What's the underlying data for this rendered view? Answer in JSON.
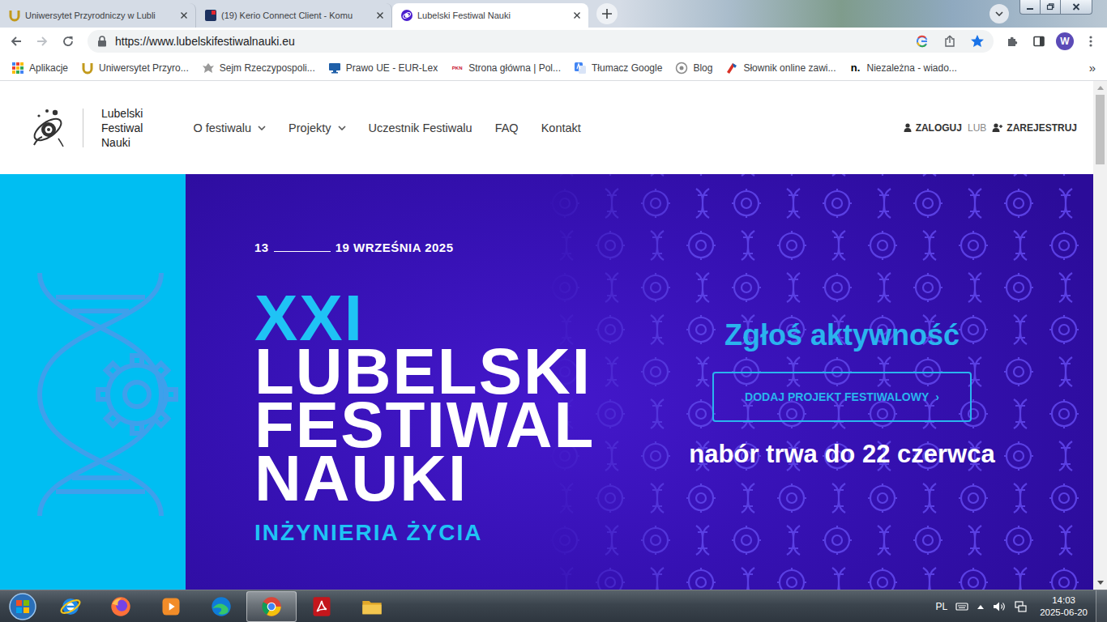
{
  "browser": {
    "tabs": [
      {
        "label": "Uniwersytet Przyrodniczy w Lubli",
        "kind": "up",
        "selected": false
      },
      {
        "label": "(19) Kerio Connect Client - Komu",
        "kind": "kerio",
        "selected": false
      },
      {
        "label": "Lubelski Festiwal Nauki",
        "kind": "lfn",
        "selected": true
      }
    ],
    "address": "https://www.lubelskifestiwalnauki.eu",
    "bookmarked": true,
    "profile": "W",
    "bookmarks": [
      {
        "label": "Aplikacje",
        "kind": "apps"
      },
      {
        "label": "Uniwersytet Przyro...",
        "kind": "up"
      },
      {
        "label": "Sejm Rzeczypospoli...",
        "kind": "sejm"
      },
      {
        "label": "Prawo UE - EUR-Lex",
        "kind": "eurlex"
      },
      {
        "label": "Strona główna | Pol...",
        "kind": "pkn",
        "mark": "PKN"
      },
      {
        "label": "Tłumacz Google",
        "kind": "translate"
      },
      {
        "label": "Blog",
        "kind": "blog"
      },
      {
        "label": "Słownik online zawi...",
        "kind": "slownik"
      },
      {
        "label": "Niezależna - wiado...",
        "kind": "niezalezna",
        "mark": "n."
      }
    ],
    "bookmarks_more": "»",
    "scrollbar": {
      "position": 0,
      "visible_share": 0.145
    }
  },
  "site": {
    "logo": [
      "Lubelski",
      "Festiwal",
      "Nauki"
    ],
    "nav": [
      {
        "label": "O festiwalu",
        "has_menu": true
      },
      {
        "label": "Projekty",
        "has_menu": true
      },
      {
        "label": "Uczestnik Festiwalu",
        "has_menu": false
      },
      {
        "label": "FAQ",
        "has_menu": false
      },
      {
        "label": "Kontakt",
        "has_menu": false
      }
    ],
    "auth": {
      "login": "ZALOGUJ",
      "or": "LUB",
      "register": "ZAREJESTRUJ"
    }
  },
  "hero": {
    "date_start": "13",
    "date_end": "19 WRZEŚNIA 2025",
    "edition": "XXI",
    "title": [
      "LUBELSKI",
      "FESTIWAL",
      "NAUKI"
    ],
    "theme": "INŻYNIERIA ŻYCIA",
    "cta_heading": "Zgłoś aktywność",
    "cta_button": "DODAJ PROJEKT FESTIWALOWY",
    "cta_arrow": "›",
    "deadline": "nabór trwa do 22 czerwca"
  },
  "taskbar": {
    "apps": [
      {
        "kind": "ie",
        "selected": false
      },
      {
        "kind": "firefox",
        "selected": false
      },
      {
        "kind": "media",
        "selected": false
      },
      {
        "kind": "edge",
        "selected": false
      },
      {
        "kind": "chrome",
        "selected": true
      },
      {
        "kind": "acrobat",
        "selected": false
      },
      {
        "kind": "explorer",
        "selected": false
      }
    ],
    "language": "PL",
    "time": "14:03",
    "date": "2025-06-20"
  }
}
